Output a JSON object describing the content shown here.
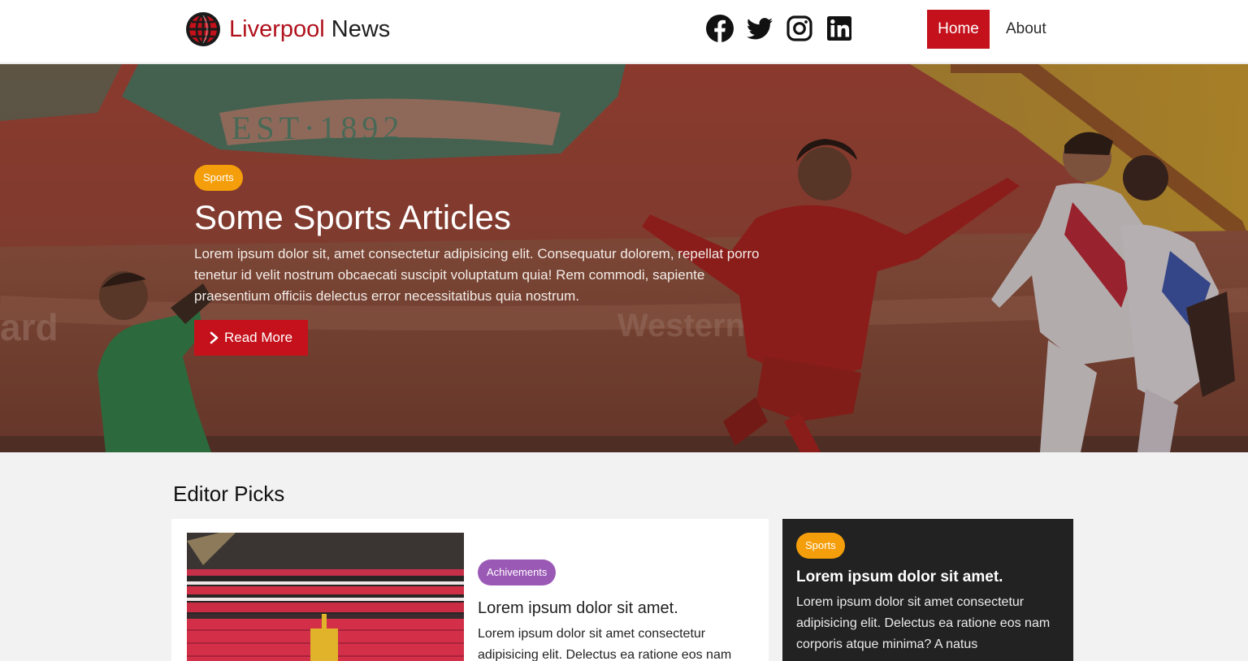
{
  "navbar": {
    "brand_primary": "Liverpool",
    "brand_secondary": "News",
    "socials": [
      "facebook-icon",
      "twitter-icon",
      "instagram-icon",
      "linkedin-icon"
    ],
    "links": [
      {
        "label": "Home",
        "active": true
      },
      {
        "label": "About",
        "active": false
      }
    ]
  },
  "hero": {
    "badge": "Sports",
    "title": "Some Sports Articles",
    "text": "Lorem ipsum dolor sit, amet consectetur adipisicing elit. Consequatur dolorem, repellat porro tenetur id velit nostrum obcaecati suscipit voluptatum quia! Rem commodi, sapiente praesentium officiis delectus error necessitatibus quia nostrum.",
    "button_label": "Read More",
    "button_icon": "chevron-right-icon"
  },
  "editor_picks": {
    "title": "Editor Picks",
    "main_card": {
      "badge": "Achivements",
      "title": "Lorem ipsum dolor sit amet.",
      "text": "Lorem ipsum dolor sit amet consectetur adipisicing elit. Delectus ea ratione eos nam"
    },
    "side_card": {
      "badge": "Sports",
      "title": "Lorem ipsum dolor sit amet.",
      "text": "Lorem ipsum dolor sit amet consectetur adipisicing elit. Delectus ea ratione eos nam corporis atque minima? A natus"
    }
  },
  "colors": {
    "brand_red": "#c4111b",
    "sports_badge": "#f59e0b",
    "achievements_badge": "#9b59b6",
    "dark_card": "#222222"
  }
}
